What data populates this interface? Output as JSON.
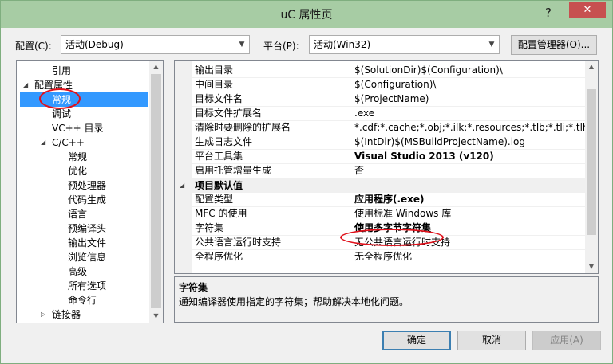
{
  "window": {
    "title": "uC 属性页",
    "help": "?",
    "close": "✕"
  },
  "config": {
    "label": "配置(C):",
    "value": "活动(Debug)"
  },
  "platform": {
    "label": "平台(P):",
    "value": "活动(Win32)"
  },
  "config_manager_button": "配置管理器(O)...",
  "tree": {
    "items": [
      {
        "label": "引用",
        "expander": ""
      },
      {
        "label": "配置属性",
        "expander": "◢"
      },
      {
        "label": "常规",
        "expander": "",
        "selected": true
      },
      {
        "label": "调试",
        "expander": ""
      },
      {
        "label": "VC++ 目录",
        "expander": ""
      },
      {
        "label": "C/C++",
        "expander": "◢"
      },
      {
        "label": "常规",
        "expander": ""
      },
      {
        "label": "优化",
        "expander": ""
      },
      {
        "label": "预处理器",
        "expander": ""
      },
      {
        "label": "代码生成",
        "expander": ""
      },
      {
        "label": "语言",
        "expander": ""
      },
      {
        "label": "预编译头",
        "expander": ""
      },
      {
        "label": "输出文件",
        "expander": ""
      },
      {
        "label": "浏览信息",
        "expander": ""
      },
      {
        "label": "高级",
        "expander": ""
      },
      {
        "label": "所有选项",
        "expander": ""
      },
      {
        "label": "命令行",
        "expander": ""
      },
      {
        "label": "链接器",
        "expander": "▷"
      }
    ]
  },
  "grid": {
    "rows": [
      {
        "name": "输出目录",
        "value": "$(SolutionDir)$(Configuration)\\",
        "bold": false
      },
      {
        "name": "中间目录",
        "value": "$(Configuration)\\",
        "bold": false
      },
      {
        "name": "目标文件名",
        "value": "$(ProjectName)",
        "bold": false
      },
      {
        "name": "目标文件扩展名",
        "value": ".exe",
        "bold": false
      },
      {
        "name": "清除时要删除的扩展名",
        "value": "*.cdf;*.cache;*.obj;*.ilk;*.resources;*.tlb;*.tli;*.tlh;*.tm",
        "bold": false
      },
      {
        "name": "生成日志文件",
        "value": "$(IntDir)$(MSBuildProjectName).log",
        "bold": false
      },
      {
        "name": "平台工具集",
        "value": "Visual Studio 2013 (v120)",
        "bold": true
      },
      {
        "name": "启用托管增量生成",
        "value": "否",
        "bold": false
      }
    ],
    "category": {
      "expander": "◢",
      "label": "项目默认值"
    },
    "rows2": [
      {
        "name": "配置类型",
        "value": "应用程序(.exe)",
        "bold": true
      },
      {
        "name": "MFC 的使用",
        "value": "使用标准 Windows 库",
        "bold": false
      },
      {
        "name": "字符集",
        "value": "使用多字节字符集",
        "bold": true
      },
      {
        "name": "公共语言运行时支持",
        "value": "无公共语言运行时支持",
        "bold": false
      },
      {
        "name": "全程序优化",
        "value": "无全程序优化",
        "bold": false
      }
    ]
  },
  "description": {
    "title": "字符集",
    "text": "通知编译器使用指定的字符集；帮助解决本地化问题。"
  },
  "buttons": {
    "ok": "确定",
    "cancel": "取消",
    "apply": "应用(A)"
  },
  "colors": {
    "annotation": "#e0101a",
    "selection": "#3399ff",
    "titlebar": "#a7cca4"
  }
}
